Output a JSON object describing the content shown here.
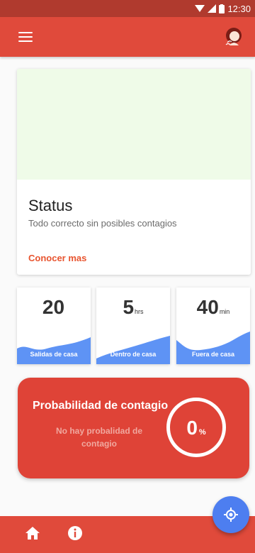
{
  "status_bar": {
    "time": "12:30"
  },
  "status_card": {
    "title": "Status",
    "description": "Todo correcto sin posibles contagios",
    "link_label": "Conocer mas"
  },
  "stats": [
    {
      "value": "20",
      "unit": "",
      "label": "Salidas de casa"
    },
    {
      "value": "5",
      "unit": "hrs",
      "label": "Dentro de casa"
    },
    {
      "value": "40",
      "unit": "min",
      "label": "Fuera de casa"
    }
  ],
  "risk": {
    "title": "Probabilidad de contagio",
    "subtitle": "No hay probalidad de contagio",
    "value": "0",
    "unit": "%"
  },
  "icons": {
    "menu": "menu-icon",
    "avatar": "woman-avatar-icon",
    "home": "home-icon",
    "info": "info-icon",
    "location": "gps-location-icon"
  },
  "colors": {
    "primary": "#e04a3b",
    "status_bar": "#b03a2e",
    "accent_link": "#e8542f",
    "wave_blue": "#5e93f5",
    "fab": "#4d7ef0"
  }
}
